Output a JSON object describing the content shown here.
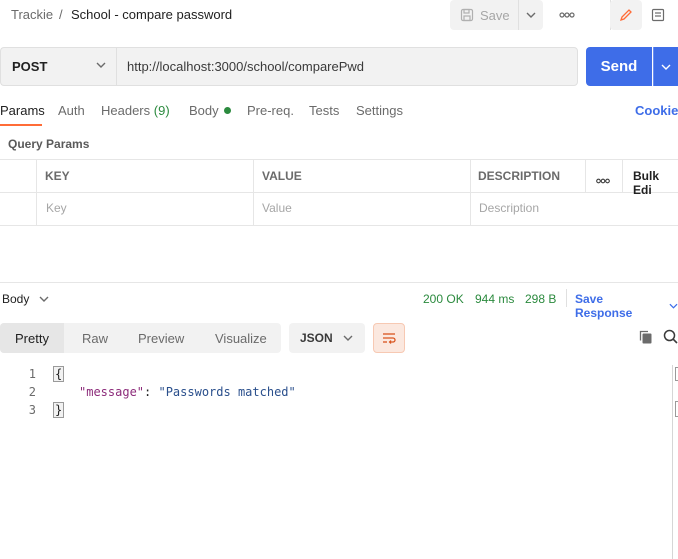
{
  "header": {
    "workspace": "Trackie",
    "separator": "/",
    "request_name": "School - compare password",
    "save_label": "Save"
  },
  "request": {
    "method": "POST",
    "url": "http://localhost:3000/school/comparePwd",
    "send_label": "Send"
  },
  "tabs": {
    "params": "Params",
    "auth": "Auth",
    "headers": "Headers",
    "headers_count": "(9)",
    "body": "Body",
    "prereq": "Pre-req.",
    "tests": "Tests",
    "settings": "Settings",
    "cookies": "Cookies"
  },
  "query_params": {
    "label": "Query Params",
    "columns": {
      "key": "KEY",
      "value": "VALUE",
      "description": "DESCRIPTION",
      "bulk_edit": "Bulk Edi"
    },
    "placeholders": {
      "key": "Key",
      "value": "Value",
      "description": "Description"
    }
  },
  "response": {
    "body_label": "Body",
    "status": "200 OK",
    "time": "944 ms",
    "size": "298 B",
    "save_response": "Save Response",
    "views": [
      "Pretty",
      "Raw",
      "Preview",
      "Visualize"
    ],
    "format": "JSON",
    "lines": [
      {
        "num": "1",
        "text": "{"
      },
      {
        "num": "2",
        "key": "\"message\"",
        "colon": ": ",
        "value": "\"Passwords matched\""
      },
      {
        "num": "3",
        "text": "}"
      }
    ]
  },
  "colors": {
    "accent": "#3e6de8",
    "status_ok": "#2b8a3e",
    "active_tab": "#ff6c37"
  }
}
